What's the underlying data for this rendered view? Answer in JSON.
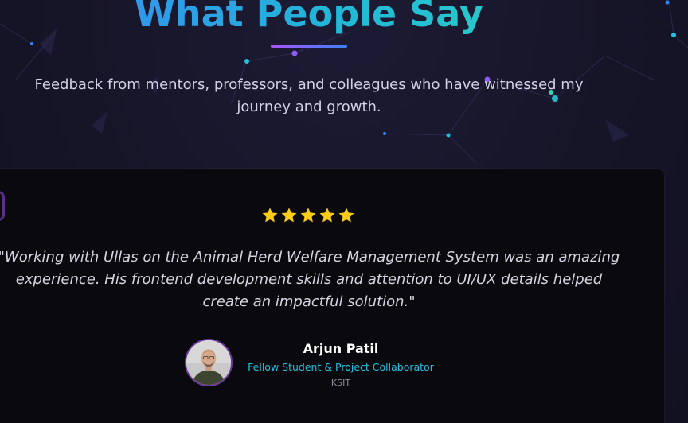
{
  "section": {
    "title": "What People Say",
    "subtitle": "Feedback from mentors, professors, and colleagues who have witnessed my journey and growth."
  },
  "testimonial": {
    "rating": 5,
    "rating_max": 5,
    "quote": "\"Working with Ullas on the Animal Herd Welfare Management System was an amazing experience. His frontend development skills and attention to UI/UX details helped create an impactful solution.\"",
    "author": {
      "name": "Arjun Patil",
      "role": "Fellow Student & Project Collaborator",
      "organization": "KSIT"
    }
  },
  "colors": {
    "title_gradient_start": "#3b82f6",
    "title_gradient_end": "#2dd4bf",
    "role_text": "#22c1e0",
    "star": "#facc15",
    "card_background": "#0a0a0e"
  },
  "icons": [
    "star-icon",
    "quote-icon"
  ]
}
